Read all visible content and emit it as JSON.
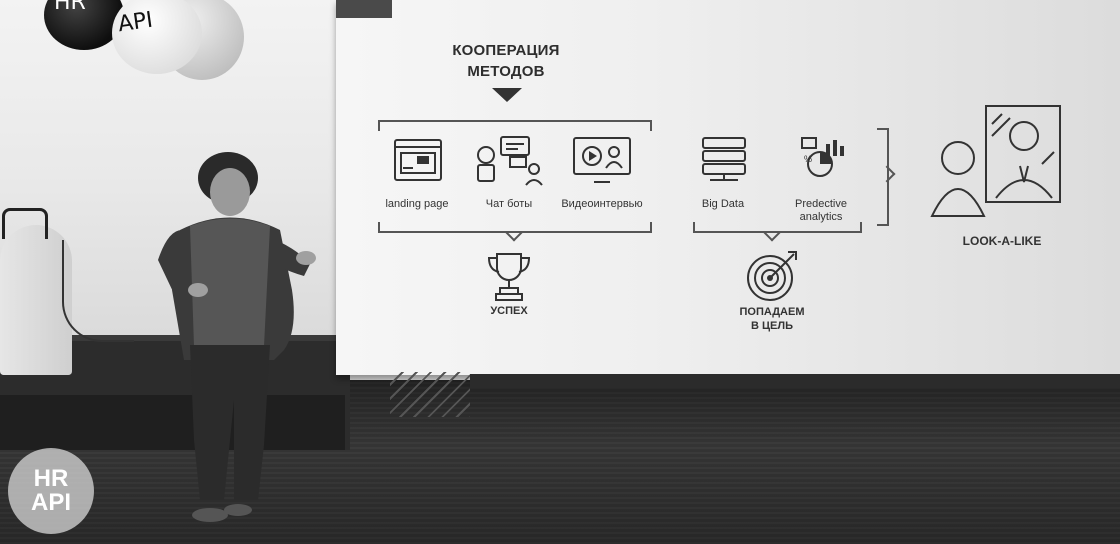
{
  "slide": {
    "title_line1": "КООПЕРАЦИЯ",
    "title_line2": "МЕТОДОВ",
    "methods": [
      {
        "icon": "landing-page-icon",
        "label": "landing page"
      },
      {
        "icon": "chat-bot-icon",
        "label": "Чат боты"
      },
      {
        "icon": "video-interview-icon",
        "label": "Видеоинтервью"
      }
    ],
    "data": [
      {
        "icon": "big-data-icon",
        "label": "Big Data"
      },
      {
        "icon": "predictive-analytics-icon",
        "label_line1": "Predective",
        "label_line2": "analytics"
      }
    ],
    "success": {
      "icon": "trophy-icon",
      "label": "УСПЕХ"
    },
    "target": {
      "icon": "target-icon",
      "label_line1": "ПОПАДАЕМ",
      "label_line2": "В ЦЕЛЬ"
    },
    "lookalike": {
      "icon": "mirror-person-icon",
      "label": "LOOK-A-LIKE"
    }
  },
  "balloons": {
    "left": "HR",
    "right": "API"
  },
  "logo": {
    "line1": "HR",
    "line2": "API"
  },
  "colors": {
    "ink": "#333333",
    "screen": "#efefef",
    "floor": "#383838"
  }
}
